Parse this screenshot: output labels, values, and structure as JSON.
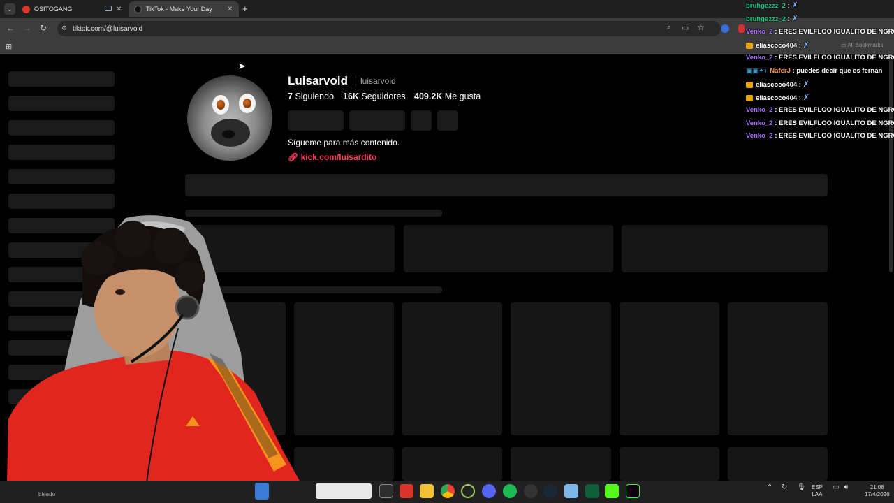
{
  "browser": {
    "tabs": [
      {
        "title": "OSITOGANG",
        "active": false
      },
      {
        "title": "TikTok - Make Your Day",
        "active": true
      }
    ],
    "new_tab": "+",
    "url": "tiktok.com/@luisarvoid",
    "bookmarks_label": "All Bookmarks"
  },
  "profile": {
    "display_name": "Luisarvoid",
    "username": "luisarvoid",
    "following_count": "7",
    "following_label": "Siguiendo",
    "followers_count": "16K",
    "followers_label": "Seguidores",
    "likes_count": "409.2K",
    "likes_label": "Me gusta",
    "bio": "Sígueme para más contenido.",
    "link": "kick.com/luisardito"
  },
  "chat": [
    {
      "user": "bruhgezzz_2",
      "color": "green",
      "message": "",
      "emote": true
    },
    {
      "user": "bruhgezzz_2",
      "color": "green",
      "message": "",
      "emote": true
    },
    {
      "user": "Venko_2",
      "color": "purple",
      "message": "ERES EVILFLOO IGUALITO DE NGRO",
      "emote": false
    },
    {
      "user": "eliascoco404",
      "color": "white",
      "message": "",
      "emote": true
    },
    {
      "user": "Venko_2",
      "color": "purple",
      "message": "ERES EVILFLOO IGUALITO DE NGRO",
      "emote": false
    },
    {
      "user": "NaferJ",
      "color": "orange",
      "message": "puedes decir que es fernan",
      "emote": false
    },
    {
      "user": "eliascoco404",
      "color": "white",
      "message": "",
      "emote": true
    },
    {
      "user": "eliascoco404",
      "color": "white",
      "message": "",
      "emote": true
    },
    {
      "user": "Venko_2",
      "color": "purple",
      "message": "ERES EVILFLOO IGUALITO DE NGRO",
      "emote": false
    },
    {
      "user": "Venko_2",
      "color": "purple",
      "message": "ERES EVILFLOO IGUALITO DE NGRO",
      "emote": false
    },
    {
      "user": "Venko_2",
      "color": "purple",
      "message": "ERES EVILFLOO IGUALITO DE NGRO",
      "emote": false
    }
  ],
  "taskbar": {
    "search_hint": "bleado",
    "lang_top": "ESP",
    "lang_bottom": "LAA",
    "time": "21:08",
    "date": "17/4/2026"
  },
  "colors": {
    "accent_link": "#ff3b5c",
    "chat_green": "#00d084",
    "chat_purple": "#a970ff",
    "chat_orange": "#ff9a3c"
  }
}
